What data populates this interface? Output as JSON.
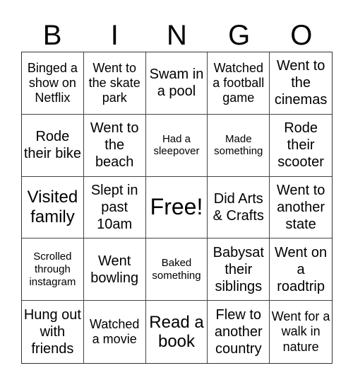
{
  "header": {
    "letters": [
      "B",
      "I",
      "N",
      "G",
      "O"
    ]
  },
  "cells": [
    {
      "text": "Binged a show on Netflix",
      "size": "md"
    },
    {
      "text": "Went to the skate park",
      "size": "md"
    },
    {
      "text": "Swam in a pool",
      "size": "lg"
    },
    {
      "text": "Watched a football game",
      "size": "md"
    },
    {
      "text": "Went to the cinemas",
      "size": "lg"
    },
    {
      "text": "Rode their bike",
      "size": "lg"
    },
    {
      "text": "Went to the beach",
      "size": "lg"
    },
    {
      "text": "Had a sleepover",
      "size": "sm"
    },
    {
      "text": "Made something",
      "size": "sm"
    },
    {
      "text": "Rode their scooter",
      "size": "lg"
    },
    {
      "text": "Visited family",
      "size": "xl"
    },
    {
      "text": "Slept in past 10am",
      "size": "lg"
    },
    {
      "text": "Free!",
      "size": "free"
    },
    {
      "text": "Did Arts & Crafts",
      "size": "lg"
    },
    {
      "text": "Went to another state",
      "size": "lg"
    },
    {
      "text": "Scrolled through instagram",
      "size": "sm"
    },
    {
      "text": "Went bowling",
      "size": "lg"
    },
    {
      "text": "Baked something",
      "size": "sm"
    },
    {
      "text": "Babysat their siblings",
      "size": "lg"
    },
    {
      "text": "Went on a roadtrip",
      "size": "lg"
    },
    {
      "text": "Hung out with friends",
      "size": "lg"
    },
    {
      "text": "Watched a movie",
      "size": "md"
    },
    {
      "text": "Read a book",
      "size": "xl"
    },
    {
      "text": "Flew to another country",
      "size": "lg"
    },
    {
      "text": "Went for a walk in nature",
      "size": "md"
    }
  ]
}
